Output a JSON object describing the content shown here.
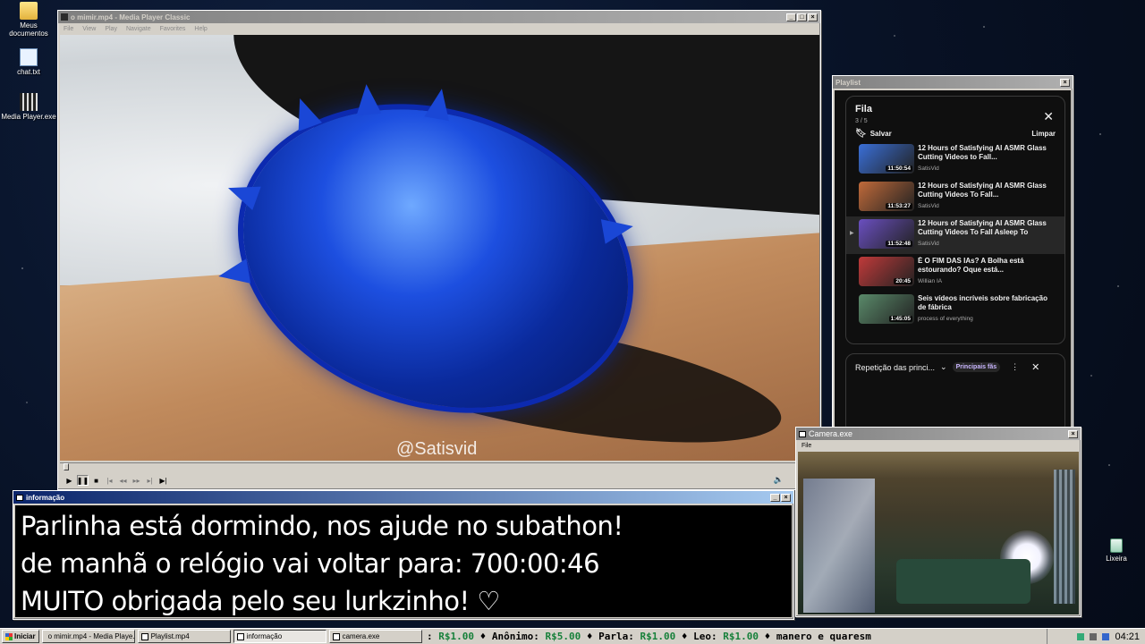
{
  "desktop": {
    "icons": [
      {
        "label": "Meus documentos",
        "icon": "folder-icon"
      },
      {
        "label": "chat.txt",
        "icon": "text-file-icon"
      },
      {
        "label": "Media Player.exe",
        "icon": "media-player-icon"
      },
      {
        "label": "Lixeira",
        "icon": "recycle-bin-icon"
      }
    ]
  },
  "media_player": {
    "title": "o mimir.mp4 - Media Player Classic",
    "menu": [
      "File",
      "View",
      "Play",
      "Navigate",
      "Favorites",
      "Help"
    ],
    "watermark": "@Satisvid"
  },
  "playlist_window": {
    "title": "Playlist",
    "panel_title": "Fila",
    "position": "3 / 5",
    "save_label": "Salvar",
    "clear_label": "Limpar",
    "items": [
      {
        "title": "12 Hours of Satisfying AI ASMR Glass Cutting Videos to Fall...",
        "channel": "SatisVid",
        "duration": "11:50:54",
        "color": "#3a6fd8"
      },
      {
        "title": "12 Hours of Satisfying AI ASMR Glass Cutting Videos To Fall...",
        "channel": "SatisVid",
        "duration": "11:53:27",
        "color": "#c06a3a"
      },
      {
        "title": "12 Hours of Satisfying AI ASMR Glass Cutting Videos To Fall Asleep To",
        "channel": "SatisVid",
        "duration": "11:52:48",
        "color": "#6a4fc0"
      },
      {
        "title": "É O FIM DAS IAs? A Bolha está estourando? Oque está...",
        "channel": "Willian IA",
        "duration": "20:45",
        "color": "#c03a3a"
      },
      {
        "title": "Seis vídeos incríveis sobre fabricação de fábrica",
        "channel": "process of everything",
        "duration": "1:45:05",
        "color": "#5a8a6a"
      }
    ],
    "loop_label": "Repetição das princi...",
    "loop_chip": "Principais fãs"
  },
  "info_window": {
    "title": "informação",
    "lines": [
      "Parlinha está dormindo, nos ajude no subathon!",
      "de manhã o relógio vai voltar para:  700:00:46",
      "MUITO obrigada pelo seu lurkzinho! ♡"
    ]
  },
  "camera_window": {
    "title": "Camera.exe",
    "menu": [
      "File"
    ]
  },
  "taskbar": {
    "start_label": "Iniciar",
    "tasks": [
      {
        "label": "o mimir.mp4 - Media Playe...",
        "active": false
      },
      {
        "label": "Playlist.mp4",
        "active": false
      },
      {
        "label": "informação",
        "active": true
      },
      {
        "label": "camera.exe",
        "active": false
      }
    ],
    "ticker": [
      {
        "name": "",
        "amount": "R$1.00"
      },
      {
        "name": "Anônimo",
        "amount": "R$5.00"
      },
      {
        "name": "Parla",
        "amount": "R$1.00"
      },
      {
        "name": "Leo",
        "amount": "R$1.00"
      },
      {
        "name": "manero e quaresm",
        "amount": ""
      }
    ],
    "clock": "04:21"
  },
  "colors": {
    "title_active": "#0a246a",
    "title_inactive": "#808080",
    "window_face": "#d4d0c8",
    "ticker_money": "#16803a"
  }
}
